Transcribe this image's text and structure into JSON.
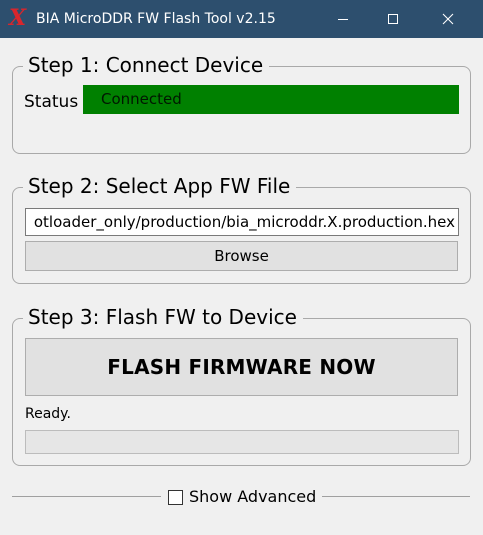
{
  "window": {
    "title": "BIA MicroDDR FW Flash Tool v2.15",
    "icon": "x-logo-icon",
    "icon_glyph": "X",
    "icon_color": "#d9262c",
    "titlebar_color": "#2d4f6e"
  },
  "step1": {
    "legend": "Step 1: Connect Device",
    "status_label": "Status",
    "status_value": "Connected",
    "status_color": "#008000"
  },
  "step2": {
    "legend": "Step 2: Select App FW File",
    "file_path": "otloader_only/production/bia_microddr.X.production.hex",
    "browse_label": "Browse"
  },
  "step3": {
    "legend": "Step 3: Flash FW to Device",
    "flash_label": "FLASH FIRMWARE NOW",
    "status_text": "Ready.",
    "progress": 0
  },
  "advanced": {
    "label": "Show Advanced",
    "checked": false
  }
}
